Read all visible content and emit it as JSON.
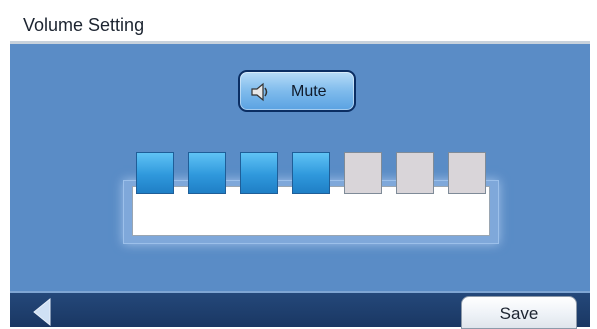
{
  "header": {
    "title": "Volume Setting"
  },
  "mute_button": {
    "label": "Mute",
    "icon": "speaker-icon"
  },
  "volume": {
    "level": 4,
    "max": 7
  },
  "footer": {
    "back_icon": "back-arrow-icon",
    "save_label": "Save"
  },
  "colors": {
    "accent_blue": "#5a8cc6",
    "segment_on": "#2f98dc",
    "segment_off": "#d9d5d9",
    "footer_bar": "#1a3763"
  }
}
